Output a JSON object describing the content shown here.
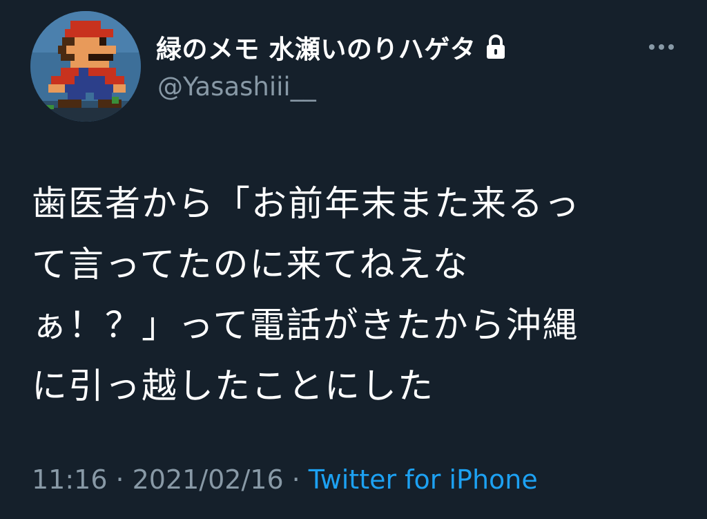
{
  "user": {
    "display_name": "緑のメモ 水瀬いのりハゲタ",
    "handle": "@Yasashiii__",
    "protected_icon": "lock-icon"
  },
  "menu": {
    "icon": "more-horizontal-icon"
  },
  "tweet": {
    "lines": [
      "歯医者から「お前年末また来るっ",
      "て言ってたのに来てねえな",
      "ぁ！？」って電話がきたから沖縄",
      "に引っ越したことにした"
    ]
  },
  "meta": {
    "time": "11:16",
    "separator": "·",
    "date": "2021/02/16",
    "source": "Twitter for iPhone"
  },
  "colors": {
    "background": "#15202b",
    "text": "#ffffff",
    "muted": "#8899a6",
    "link": "#1da1f2"
  }
}
